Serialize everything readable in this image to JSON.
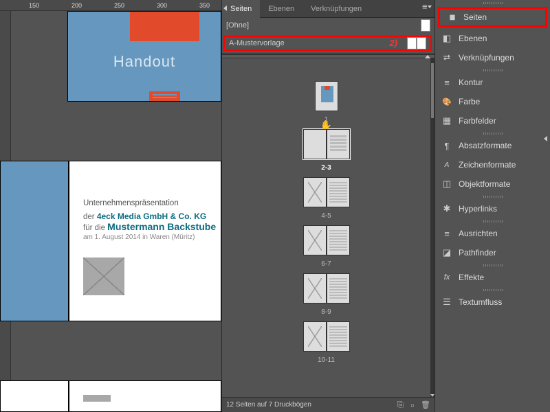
{
  "ruler": {
    "ticks": [
      "150",
      "200",
      "250",
      "300",
      "350"
    ]
  },
  "canvas": {
    "page1_title": "Handout",
    "pres": {
      "title": "Unternehmenspräsentation",
      "line1_prefix": "der ",
      "line1_bold": "4eck Media GmbH & Co. KG",
      "line2_prefix": "für die ",
      "line2_bold": "Mustermann Backstube",
      "line3": "am 1. August 2014 in Waren (Müritz)"
    }
  },
  "pagesPanel": {
    "tabs": [
      "Seiten",
      "Ebenen",
      "Verknüpfungen"
    ],
    "activeTab": 0,
    "masters": {
      "none": "[Ohne]",
      "a_master": "A-Mustervorlage",
      "highlight_number": "2)"
    },
    "spreads": [
      {
        "label": "1"
      },
      {
        "label": "2-3"
      },
      {
        "label": "4-5"
      },
      {
        "label": "6-7"
      },
      {
        "label": "8-9"
      },
      {
        "label": "10-11"
      }
    ],
    "footer": "12 Seiten auf 7 Druckbögen"
  },
  "sidebar": {
    "groups": [
      [
        {
          "key": "pages",
          "label": "Seiten",
          "highlight": true
        },
        {
          "key": "layers",
          "label": "Ebenen"
        },
        {
          "key": "links",
          "label": "Verknüpfungen"
        }
      ],
      [
        {
          "key": "stroke",
          "label": "Kontur"
        },
        {
          "key": "color",
          "label": "Farbe"
        },
        {
          "key": "swatch",
          "label": "Farbfelder"
        }
      ],
      [
        {
          "key": "parastyle",
          "label": "Absatzformate"
        },
        {
          "key": "charstyle",
          "label": "Zeichenformate"
        },
        {
          "key": "objstyle",
          "label": "Objektformate"
        }
      ],
      [
        {
          "key": "hyperlink",
          "label": "Hyperlinks"
        }
      ],
      [
        {
          "key": "align",
          "label": "Ausrichten"
        },
        {
          "key": "pathfinder",
          "label": "Pathfinder"
        }
      ],
      [
        {
          "key": "fx",
          "label": "Effekte"
        }
      ],
      [
        {
          "key": "textwrap",
          "label": "Textumfluss"
        }
      ]
    ]
  }
}
